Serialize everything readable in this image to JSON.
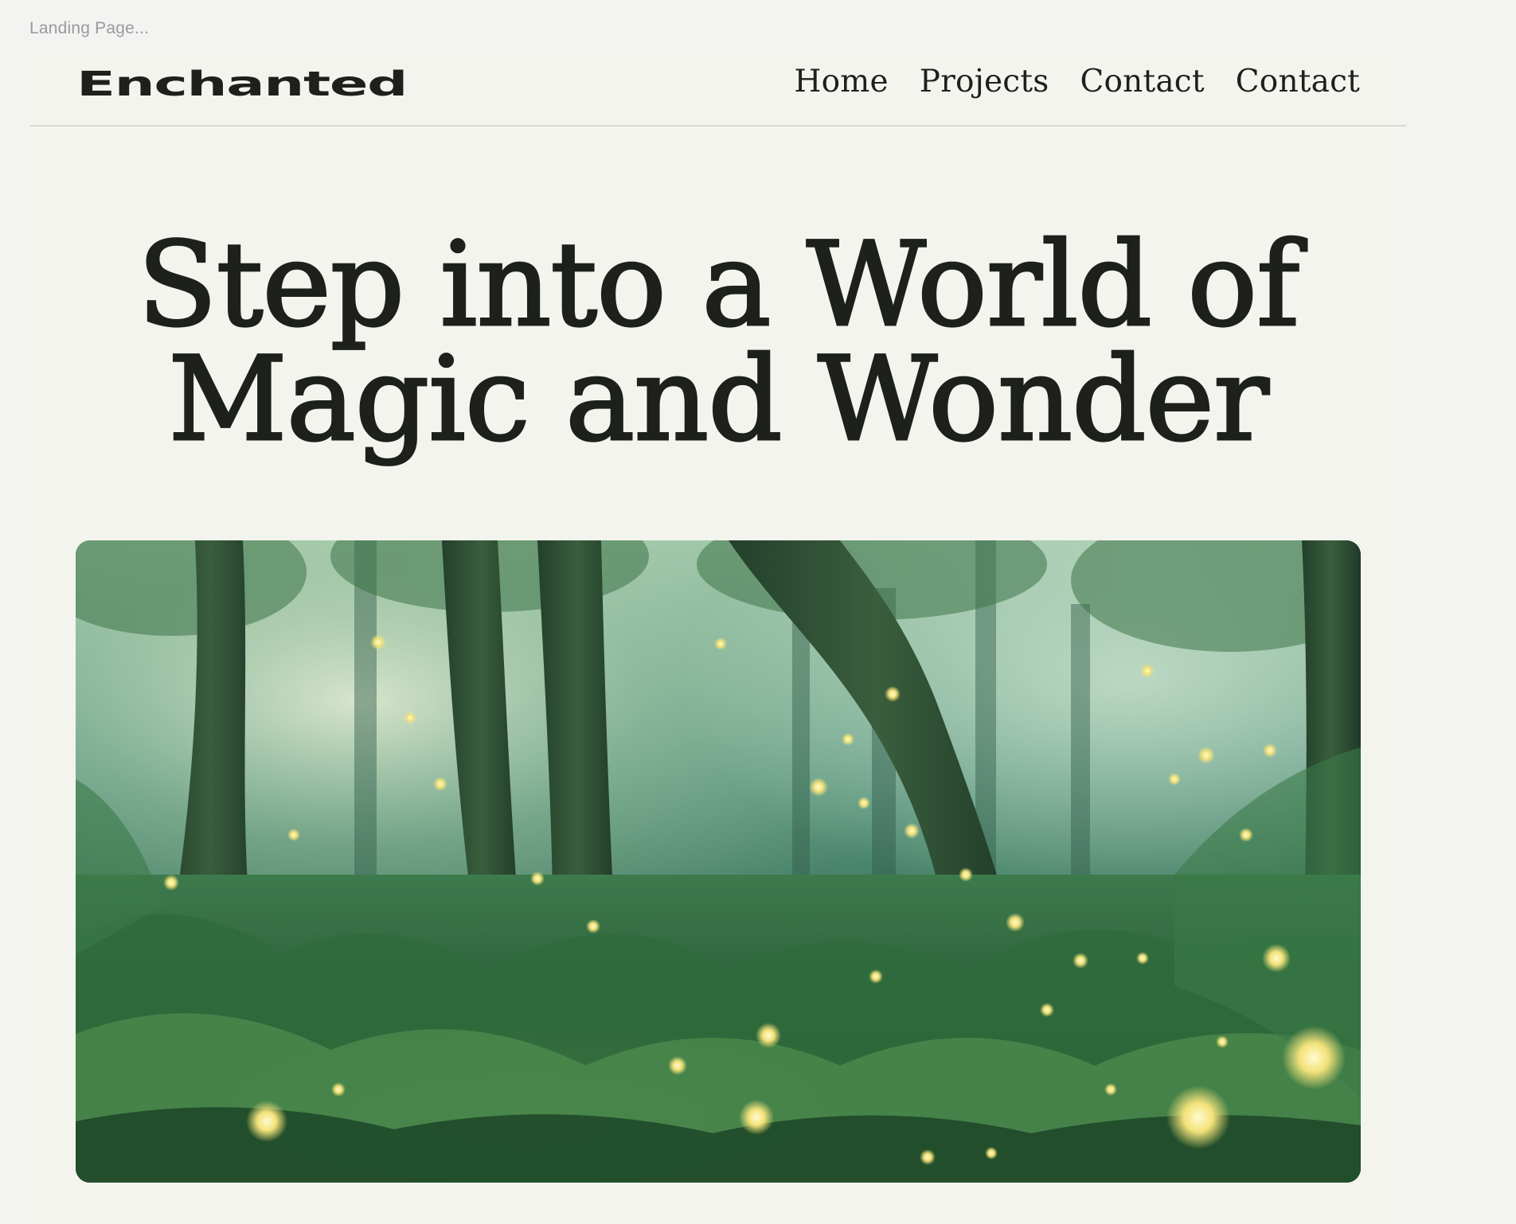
{
  "canvas": {
    "label": "Landing Page..."
  },
  "header": {
    "logo": "Enchanted",
    "nav": [
      {
        "label": "Home"
      },
      {
        "label": "Projects"
      },
      {
        "label": "Contact"
      },
      {
        "label": "Contact"
      }
    ]
  },
  "hero": {
    "title_line1": "Step into a World of",
    "title_line2": "Magic and Wonder",
    "image_subject": "enchanted-forest-with-fireflies"
  },
  "colors": {
    "page_background": "#f3f3f2",
    "frame_background": "#f4f4ef",
    "text": "#1d201b",
    "divider": "#d8d8d3",
    "forest_green": "#3f7a55",
    "firefly": "#f3e27a"
  }
}
